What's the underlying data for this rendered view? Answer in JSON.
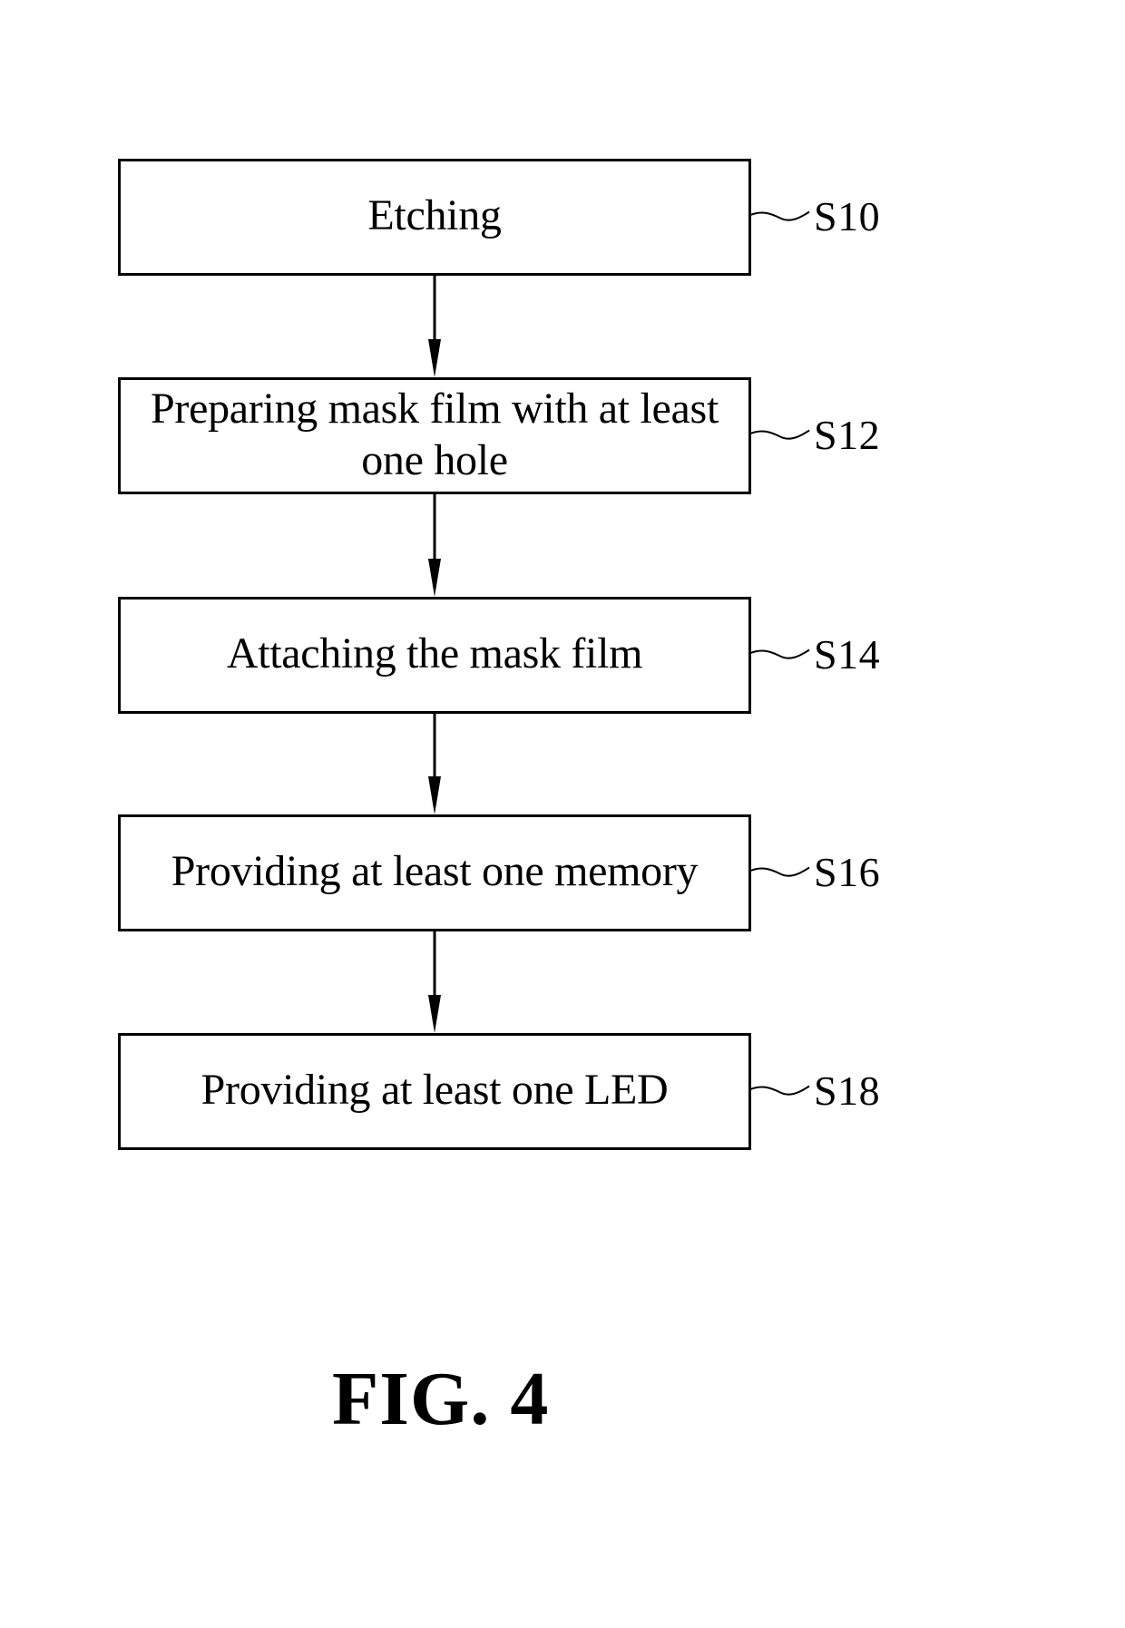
{
  "figure": {
    "caption": "FIG. 4",
    "type": "flowchart",
    "direction": "top-to-bottom"
  },
  "steps": [
    {
      "id": "S10",
      "label": "S10",
      "text": "Etching"
    },
    {
      "id": "S12",
      "label": "S12",
      "text": "Preparing mask film with at least one hole"
    },
    {
      "id": "S14",
      "label": "S14",
      "text": "Attaching the mask film"
    },
    {
      "id": "S16",
      "label": "S16",
      "text": "Providing at least one memory"
    },
    {
      "id": "S18",
      "label": "S18",
      "text": "Providing at least one LED"
    }
  ],
  "connections": [
    {
      "from": "S10",
      "to": "S12"
    },
    {
      "from": "S12",
      "to": "S14"
    },
    {
      "from": "S14",
      "to": "S16"
    },
    {
      "from": "S16",
      "to": "S18"
    }
  ],
  "colors": {
    "line": "#000000",
    "background": "#ffffff"
  }
}
